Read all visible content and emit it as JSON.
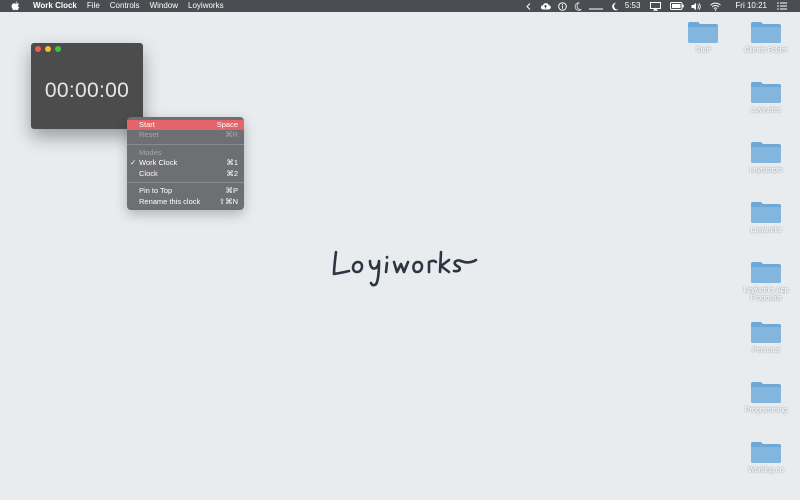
{
  "menubar": {
    "app_name": "Work Clock",
    "menus": [
      "File",
      "Controls",
      "Window",
      "Loyiworks"
    ],
    "status_time": "5:53",
    "clock": "Fri 10:21"
  },
  "clock_window": {
    "time": "00:00:00"
  },
  "context_menu": {
    "start": {
      "label": "Start",
      "shortcut": "Space"
    },
    "reset": {
      "label": "Reset",
      "shortcut": "⌘R"
    },
    "modes_header": "Modes",
    "work_clock": {
      "label": "Work Clock",
      "shortcut": "⌘1",
      "check": "✓"
    },
    "clock": {
      "label": "Clock",
      "shortcut": "⌘2"
    },
    "pin_to_top": {
      "label": "Pin to Top",
      "shortcut": "⌘P"
    },
    "rename": {
      "label": "Rename this clock",
      "shortcut": "⇧⌘N"
    }
  },
  "logo_text": "Loyiworks",
  "desktop_icons": [
    {
      "label": "Stuff"
    },
    {
      "label": "Clients Folder"
    },
    {
      "label": "Loyinotes"
    },
    {
      "label": "Loyiscripts"
    },
    {
      "label": "Loyiworks"
    },
    {
      "label": "Loyiworks App Proposals"
    },
    {
      "label": "Personal"
    },
    {
      "label": "Programming"
    },
    {
      "label": "Working on"
    }
  ],
  "colors": {
    "menubar": "#4b4d52",
    "desktop": "#e9ecef",
    "highlight": "#e46569",
    "folder": "#6ea8d6"
  }
}
